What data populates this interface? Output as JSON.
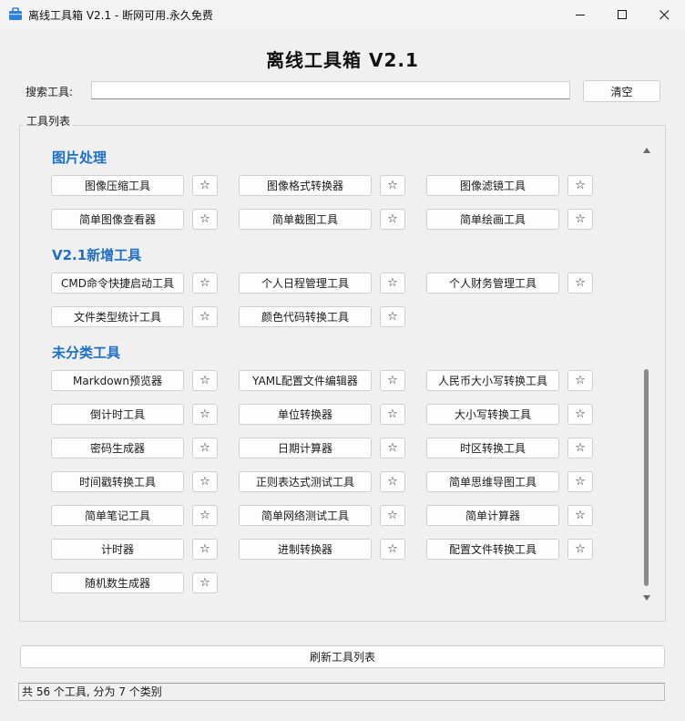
{
  "window": {
    "title": "离线工具箱 V2.1 - 断网可用.永久免费",
    "minimize_icon": "minimize-icon",
    "maximize_icon": "maximize-icon",
    "close_icon": "close-icon"
  },
  "header": {
    "title": "离线工具箱 V2.1"
  },
  "search": {
    "label": "搜索工具:",
    "value": "",
    "placeholder": "",
    "clear_label": "清空"
  },
  "tools_group": {
    "label": "工具列表"
  },
  "star_label": "☆",
  "categories": [
    {
      "name": "图片处理",
      "tools": [
        "图像压缩工具",
        "图像格式转换器",
        "图像滤镜工具",
        "简单图像查看器",
        "简单截图工具",
        "简单绘画工具"
      ]
    },
    {
      "name": "V2.1新增工具",
      "tools": [
        "CMD命令快捷启动工具",
        "个人日程管理工具",
        "个人财务管理工具",
        "文件类型统计工具",
        "颜色代码转换工具"
      ]
    },
    {
      "name": "未分类工具",
      "tools": [
        "Markdown预览器",
        "YAML配置文件编辑器",
        "人民币大小写转换工具",
        "倒计时工具",
        "单位转换器",
        "大小写转换工具",
        "密码生成器",
        "日期计算器",
        "时区转换工具",
        "时间戳转换工具",
        "正则表达式测试工具",
        "简单思维导图工具",
        "简单笔记工具",
        "简单网络测试工具",
        "简单计算器",
        "计时器",
        "进制转换器",
        "配置文件转换工具",
        "随机数生成器"
      ]
    }
  ],
  "refresh": {
    "label": "刷新工具列表"
  },
  "status": {
    "text": "共 56 个工具, 分为 7 个类别"
  },
  "colors": {
    "category_title": "#1d6fc7",
    "app_icon": "#2f7fd8"
  }
}
